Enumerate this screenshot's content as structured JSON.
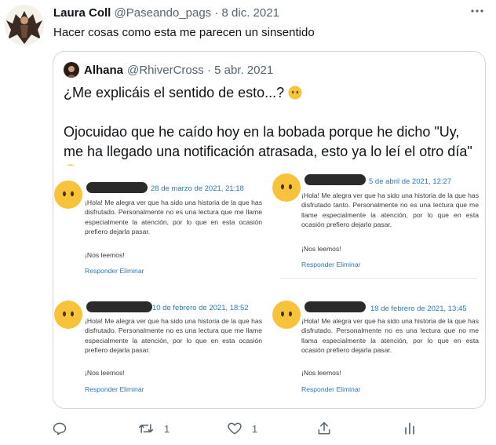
{
  "tweet": {
    "author_name": "Laura Coll",
    "handle": "@Paseando_pags",
    "separator": "·",
    "date": "8 dic. 2021",
    "text": "Hacer cosas como esta me parecen un sinsentido"
  },
  "quoted": {
    "author_name": "Alhana",
    "handle": "@RhiverCross",
    "separator": "·",
    "date": "5 abr. 2021",
    "line1": "¿Me explicáis el sentido de esto...?",
    "line2": "Ojocuidao que he caído hoy en la bobada porque he dicho \"Uy, me ha llegado una notificación atrasada, esto ya lo leí el otro día\""
  },
  "comments": [
    {
      "date": "28 de marzo de 2021, 21:18",
      "body": "¡Hola! Me alegra ver que ha sido una historia de la que has disfrutado. Personalmente no es una lectura que me llame especialmente la atención, por lo que en esta ocasión prefiero dejarla pasar.",
      "sign": "¡Nos leemos!",
      "reply": "Responder",
      "delete": "Eliminar"
    },
    {
      "date": "5 de abril de 2021, 12:27",
      "body": "¡Hola! Me alegra ver que ha sido una historia de la que has disfrutado tanto. Personalmente no es una lectura que me llame especialmente la atención, por lo que en esta ocasión prefiero dejarlo pasar.",
      "sign": "¡Nos leemos!",
      "reply": "Responder",
      "delete": "Eliminar"
    },
    {
      "date": "10 de febrero de 2021, 18:52",
      "body": "¡Hola! Me alegra ver que ha sido una historia de la que has disfrutado. Personalmente no es una lectura que me llame especialmente la atención, por lo que en esta ocasión prefiero dejarla pasar.",
      "sign": "¡Nos leemos!",
      "reply": "Responder",
      "delete": "Eliminar"
    },
    {
      "date": "19 de febrero de 2021, 13:45",
      "body": "¡Hola! Me alegra ver que ha sido una historia de la que has disfrutado. Personalmente no es una lectura que no me llama especialmente la atención, por lo que en esta ocasión prefiero dejarla pasar.",
      "sign": "¡Nos leemos!",
      "reply": "Responder",
      "delete": "Eliminar"
    }
  ],
  "actions": {
    "retweets": "1",
    "likes": "1"
  },
  "colors": {
    "text": "#0f1419",
    "secondary": "#536471",
    "link_blue": "#2a7ab0",
    "emoji_yellow": "#f7c33b"
  },
  "icons": [
    "more-icon",
    "reply-icon",
    "retweet-icon",
    "like-icon",
    "share-icon",
    "analytics-icon",
    "neutral-face-emoji",
    "rofl-emoji"
  ]
}
